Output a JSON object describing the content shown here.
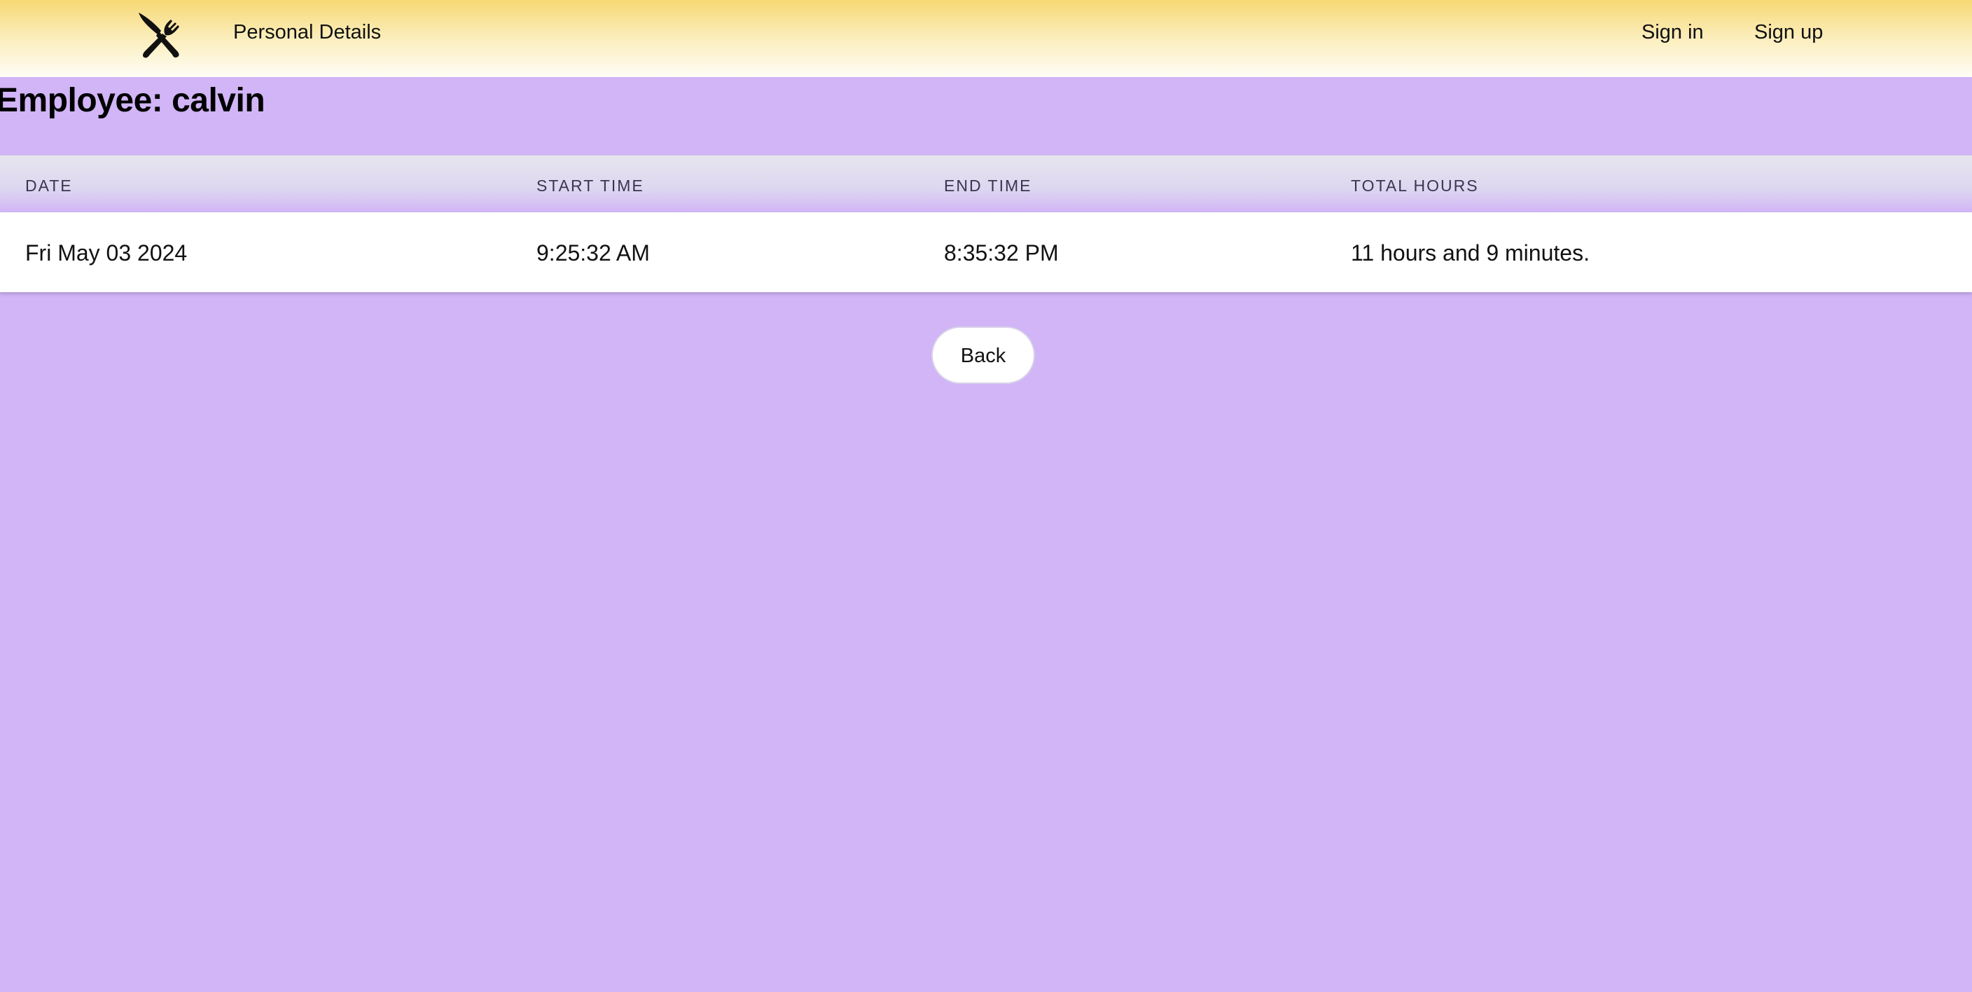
{
  "navbar": {
    "logo_icon": "fork-knife-icon",
    "links": {
      "personal_details": "Personal Details",
      "sign_in": "Sign in",
      "sign_up": "Sign up"
    },
    "colors": {
      "gradient_top": "#f7d874",
      "gradient_bottom": "#fffdf6"
    }
  },
  "page": {
    "title": "Employee: calvin",
    "background": "#d1b5f6"
  },
  "table": {
    "headers": [
      "DATE",
      "START TIME",
      "END TIME",
      "TOTAL HOURS"
    ],
    "rows": [
      [
        "Fri May 03 2024",
        "9:25:32 AM",
        "8:35:32 PM",
        "11 hours and 9 minutes."
      ]
    ]
  },
  "actions": {
    "back_label": "Back"
  }
}
